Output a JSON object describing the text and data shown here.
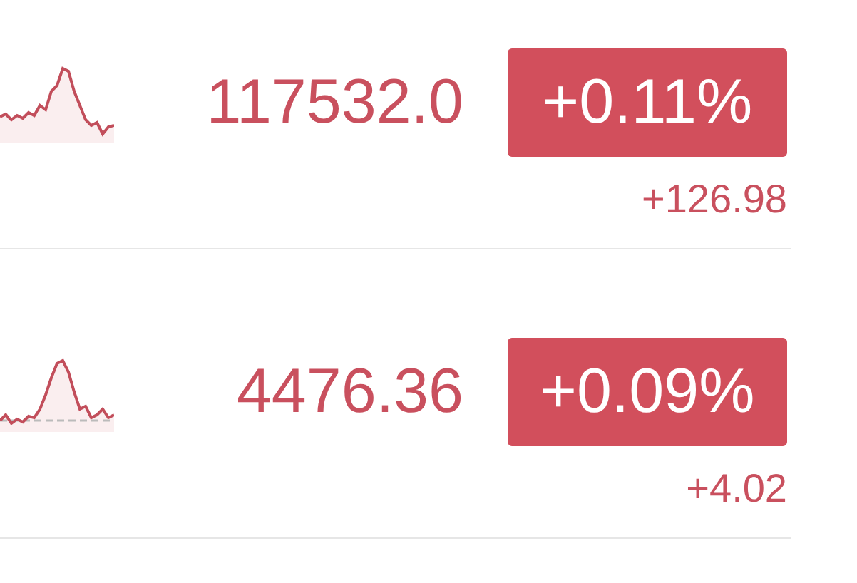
{
  "quotes": [
    {
      "price": "117532.0",
      "change_percent": "+0.11%",
      "change": "+126.98"
    },
    {
      "price": "4476.36",
      "change_percent": "+0.09%",
      "change": "+4.02"
    }
  ]
}
